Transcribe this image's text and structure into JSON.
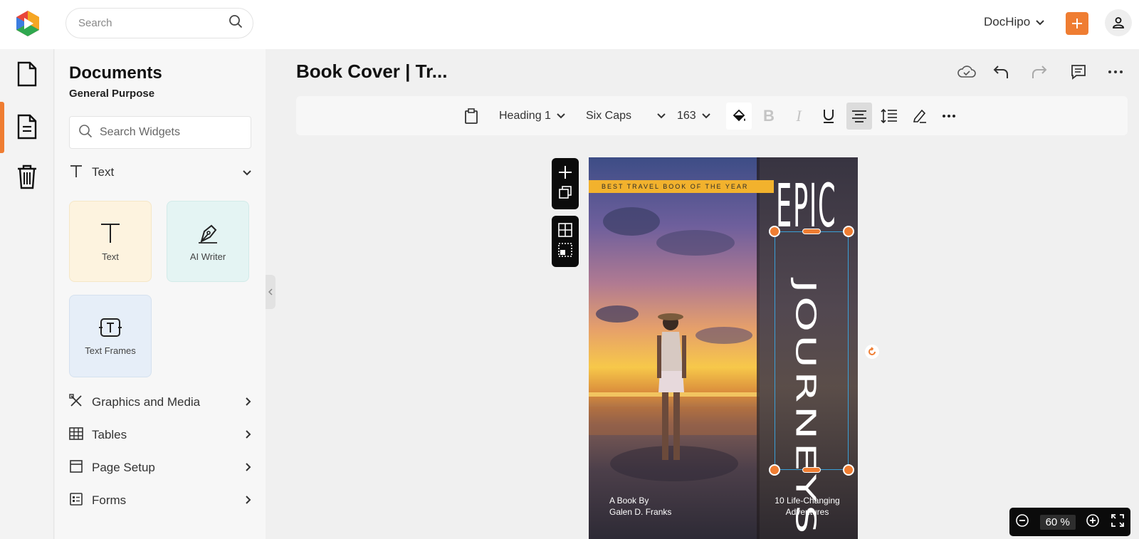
{
  "header": {
    "search_placeholder": "Search",
    "org_name": "DocHipo",
    "accent": "#ef7d32"
  },
  "rail": {
    "items": [
      "document-icon",
      "document-text-icon",
      "trash-icon"
    ],
    "active_index": 1
  },
  "panel": {
    "title": "Documents",
    "subtitle": "General Purpose",
    "search_placeholder": "Search Widgets",
    "text_section": "Text",
    "tiles": [
      {
        "label": "Text",
        "color": "#fdf3df"
      },
      {
        "label": "AI Writer",
        "color": "#e4f4f3"
      },
      {
        "label": "Text Frames",
        "color": "#e6eef8"
      }
    ],
    "sections": [
      "Graphics and Media",
      "Tables",
      "Page Setup",
      "Forms"
    ]
  },
  "editor": {
    "doc_title": "Book Cover | Tr...",
    "format": {
      "style": "Heading 1",
      "font": "Six Caps",
      "size": "163"
    }
  },
  "cover": {
    "banner": "BEST TRAVEL BOOK OF THE YEAR",
    "title_line1": "EPIC",
    "title_line2": "JOURNEYS",
    "byline_1": "A Book By",
    "byline_2": "Galen D. Franks",
    "tagline_1": "10 Life-Changing",
    "tagline_2": "Adventures",
    "banner_color": "#f2b22d"
  },
  "zoom": {
    "value": "60",
    "unit": "%"
  }
}
